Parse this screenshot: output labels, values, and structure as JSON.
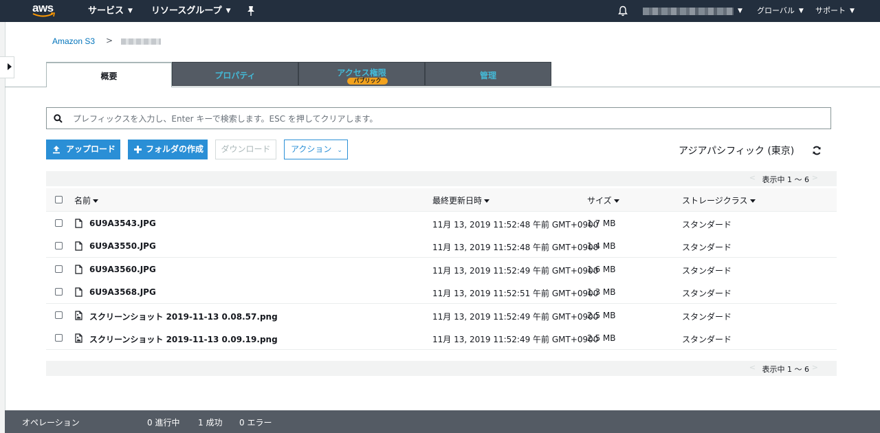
{
  "nav": {
    "logo_text": "aws",
    "services": "サービス",
    "resource_groups": "リソースグループ",
    "global": "グローバル",
    "support": "サポート"
  },
  "breadcrumb": {
    "root": "Amazon S3",
    "separator": ">"
  },
  "tabs": [
    {
      "label": "概要",
      "active": true
    },
    {
      "label": "プロパティ",
      "active": false
    },
    {
      "label": "アクセス権限",
      "active": false,
      "badge": "パブリック"
    },
    {
      "label": "管理",
      "active": false
    }
  ],
  "search": {
    "placeholder": "プレフィックスを入力し、Enter キーで検索します。ESC を押してクリアします。",
    "value": ""
  },
  "toolbar": {
    "upload": "アップロード",
    "create_folder": "フォルダの作成",
    "download": "ダウンロード",
    "actions": "アクション",
    "region": "アジアパシフィック (東京)"
  },
  "pager": {
    "label": "表示中 1 〜 6",
    "prev": "<",
    "next": ">"
  },
  "table": {
    "columns": {
      "name": "名前",
      "modified": "最終更新日時",
      "size": "サイズ",
      "storage_class": "ストレージクラス"
    },
    "rows": [
      {
        "name": "6U9A3543.JPG",
        "modified": "11月 13, 2019 11:52:48 午前 GMT+0900",
        "size": "1.7 MB",
        "storage_class": "スタンダード",
        "icon": "file-icon"
      },
      {
        "name": "6U9A3550.JPG",
        "modified": "11月 13, 2019 11:52:48 午前 GMT+0900",
        "size": "1.4 MB",
        "storage_class": "スタンダード",
        "icon": "file-icon"
      },
      {
        "name": "6U9A3560.JPG",
        "modified": "11月 13, 2019 11:52:49 午前 GMT+0900",
        "size": "1.6 MB",
        "storage_class": "スタンダード",
        "icon": "file-icon"
      },
      {
        "name": "6U9A3568.JPG",
        "modified": "11月 13, 2019 11:52:51 午前 GMT+0900",
        "size": "1.3 MB",
        "storage_class": "スタンダード",
        "icon": "file-icon"
      },
      {
        "name": "スクリーンショット 2019-11-13 0.08.57.png",
        "modified": "11月 13, 2019 11:52:49 午前 GMT+0900",
        "size": "2.5 MB",
        "storage_class": "スタンダード",
        "icon": "image-file-icon"
      },
      {
        "name": "スクリーンショット 2019-11-13 0.09.19.png",
        "modified": "11月 13, 2019 11:52:49 午前 GMT+0900",
        "size": "2.5 MB",
        "storage_class": "スタンダード",
        "icon": "image-file-icon"
      }
    ]
  },
  "operations": {
    "label": "オペレーション",
    "in_progress": "0 進行中",
    "success": "1 成功",
    "error": "0 エラー"
  },
  "colors": {
    "nav_bg": "#232f3e",
    "primary_button": "#2a8fd6",
    "tab_inactive_bg": "#545b64",
    "tab_inactive_text": "#44b9d6",
    "badge": "#f2a21d",
    "bottom_bar": "#545b64"
  }
}
